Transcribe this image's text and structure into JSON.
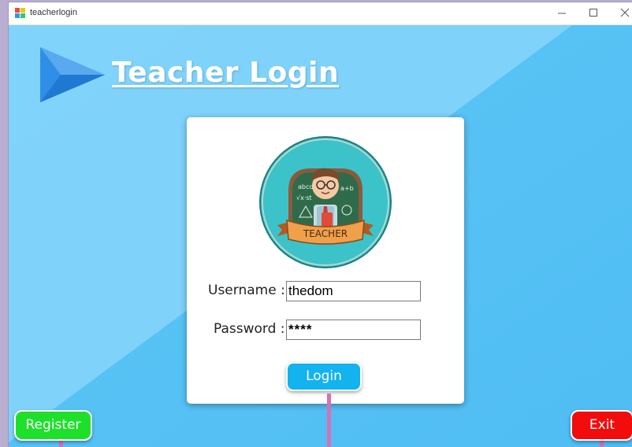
{
  "window": {
    "title": "teacherlogin",
    "app_icon": "windows-forms-app-icon",
    "controls": [
      "minimize-icon",
      "maximize-icon",
      "close-icon"
    ]
  },
  "header": {
    "title": "Teacher Login",
    "arrow_icon": "play-arrow-icon"
  },
  "form": {
    "avatar_badge_text": "TEACHER",
    "username_label": "Username :",
    "username_value": "thedom",
    "password_label": "Password :",
    "password_value": "****",
    "login_label": "Login"
  },
  "actions": {
    "register_label": "Register",
    "exit_label": "Exit"
  },
  "colors": {
    "background": "#54c1f5",
    "login_button": "#12b3ef",
    "register_button": "#1ee02b",
    "exit_button": "#f20c0c",
    "connector": "#d472b7"
  }
}
